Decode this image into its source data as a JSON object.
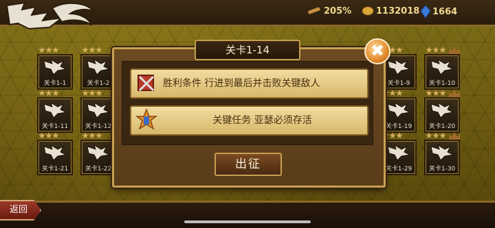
{
  "resources": [
    {
      "icon": "telescope-icon",
      "value": "205%"
    },
    {
      "icon": "gold-coin-icon",
      "value": "1132018"
    },
    {
      "icon": "blue-crystal-icon",
      "value": "1664"
    }
  ],
  "stages": [
    {
      "label": "关卡1-1"
    },
    {
      "label": "关卡1-2"
    },
    {
      "label": "关卡1-9"
    },
    {
      "label": "关卡1-10"
    },
    {
      "label": "关卡1-11"
    },
    {
      "label": "关卡1-12"
    },
    {
      "label": "关卡1-19"
    },
    {
      "label": "关卡1-20"
    },
    {
      "label": "关卡1-21"
    },
    {
      "label": "关卡1-22"
    },
    {
      "label": "关卡1-29"
    },
    {
      "label": "关卡1-30"
    }
  ],
  "dialog": {
    "title": "关卡1-14",
    "victory_text": "胜利条件 行进到最后并击败关键敌人",
    "mission_text": "关键任务 亚瑟必须存活",
    "start_label": "出征",
    "close_label": "✖"
  },
  "back_label": "返回",
  "colors": {
    "accent": "#c8a050",
    "panel": "#5a3c1a"
  }
}
